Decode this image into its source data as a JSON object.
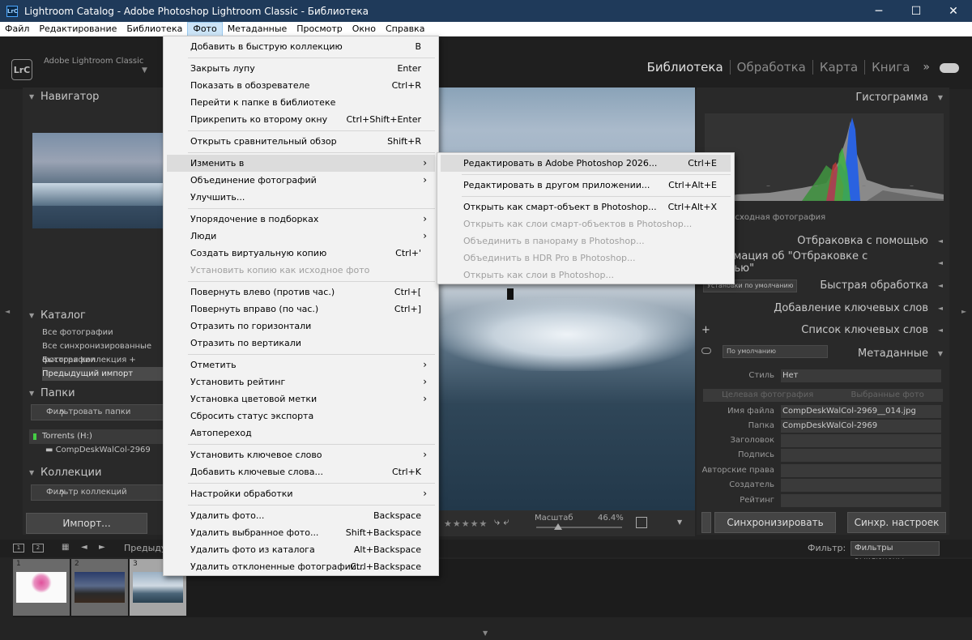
{
  "window": {
    "app_icon": "LrC",
    "title": "Lightroom Catalog - Adobe Photoshop Lightroom Classic - Библиотека",
    "minimize": "─",
    "maximize": "☐",
    "close": "✕"
  },
  "menubar": [
    "Файл",
    "Редактирование",
    "Библиотека",
    "Фото",
    "Метаданные",
    "Просмотр",
    "Окно",
    "Справка"
  ],
  "identity": {
    "badge": "LrC",
    "brand": "Adobe Lightroom Classic",
    "arrow": "▼"
  },
  "modules": {
    "items": [
      "Библиотека",
      "Обработка",
      "Карта",
      "Книга"
    ],
    "more": "»"
  },
  "left_panel": {
    "navigator": "Навигатор",
    "catalog": "Каталог",
    "catalog_items": [
      "Все фотографии",
      "Все синхронизированные фотографии",
      "Быстрая коллекция  +",
      "Предыдущий импорт"
    ],
    "folders": "Папки",
    "filter_folders": "Фильтровать папки",
    "volume": "Torrents (H:)",
    "folder_name": "CompDeskWalCol-2969",
    "collections": "Коллекции",
    "filter_collections": "Фильтр коллекций",
    "import_button": "Импорт..."
  },
  "toolbar": {
    "stars": "★★★★★",
    "rotate": "⤷ ⤶",
    "zoom_label": "Масштаб",
    "zoom_value": "46.4%",
    "zoom_level": 0.3
  },
  "right_panel": {
    "histogram": "Гистограмма",
    "hist_dashes": [
      "–",
      "–",
      "–",
      "–",
      "–"
    ],
    "original_photo": "Исходная фотография",
    "sections": [
      "Отбраковка с помощью",
      "Информация об \"Отбраковке с помощью\"",
      "Быстрая обработка",
      "Добавление ключевых слов",
      "Список ключевых слов",
      "Метаданные"
    ],
    "quick_preset": "Установки по умолчанию",
    "meta_preset": "По умолчанию",
    "style_label": "Стиль",
    "style_value": "Нет",
    "tab_target": "Целевая фотография",
    "tab_selected": "Выбранные фото",
    "metadata": [
      {
        "label": "Имя файла",
        "value": "CompDeskWalCol-2969__014.jpg"
      },
      {
        "label": "Папка",
        "value": "CompDeskWalCol-2969"
      },
      {
        "label": "Заголовок",
        "value": ""
      },
      {
        "label": "Подпись",
        "value": ""
      },
      {
        "label": "Авторские права",
        "value": ""
      },
      {
        "label": "Создатель",
        "value": ""
      },
      {
        "label": "Рейтинг",
        "value": ""
      }
    ],
    "sync_button": "Синхронизировать",
    "sync_settings_button": "Синхр. настроек"
  },
  "filmstrip_bar": {
    "monitor1": "1",
    "monitor2": "2",
    "prev": "◄",
    "next": "►",
    "source": "Предыдущий импорт",
    "filter_label": "Фильтр:",
    "filter_value": "Фильтры выключены"
  },
  "filmstrip": {
    "numbers": [
      "1",
      "2",
      "3"
    ],
    "subjects": [
      "flower",
      "landscape",
      "sea"
    ],
    "selected_index": 2
  },
  "photo_menu": {
    "items": [
      {
        "label": "Добавить в быструю коллекцию",
        "shortcut": "B",
        "arrow": "",
        "disabled": false,
        "hl": false
      },
      {
        "sep": true
      },
      {
        "label": "Закрыть лупу",
        "shortcut": "Enter",
        "arrow": "",
        "disabled": false,
        "hl": false
      },
      {
        "label": "Показать в обозревателе",
        "shortcut": "Ctrl+R",
        "arrow": "",
        "disabled": false,
        "hl": false
      },
      {
        "label": "Перейти к папке в библиотеке",
        "shortcut": "",
        "arrow": "",
        "disabled": false,
        "hl": false
      },
      {
        "label": "Прикрепить ко второму окну",
        "shortcut": "Ctrl+Shift+Enter",
        "arrow": "",
        "disabled": false,
        "hl": false
      },
      {
        "sep": true
      },
      {
        "label": "Открыть сравнительный обзор",
        "shortcut": "Shift+R",
        "arrow": "",
        "disabled": false,
        "hl": false
      },
      {
        "sep": true
      },
      {
        "label": "Изменить в",
        "shortcut": "",
        "arrow": "›",
        "disabled": false,
        "hl": true
      },
      {
        "label": "Объединение фотографий",
        "shortcut": "",
        "arrow": "›",
        "disabled": false,
        "hl": false
      },
      {
        "label": "Улучшить...",
        "shortcut": "",
        "arrow": "",
        "disabled": false,
        "hl": false
      },
      {
        "sep": true
      },
      {
        "label": "Упорядочение в подборках",
        "shortcut": "",
        "arrow": "›",
        "disabled": false,
        "hl": false
      },
      {
        "label": "Люди",
        "shortcut": "",
        "arrow": "›",
        "disabled": false,
        "hl": false
      },
      {
        "label": "Создать виртуальную копию",
        "shortcut": "Ctrl+'",
        "arrow": "",
        "disabled": false,
        "hl": false
      },
      {
        "label": "Установить копию как исходное фото",
        "shortcut": "",
        "arrow": "",
        "disabled": true,
        "hl": false
      },
      {
        "sep": true
      },
      {
        "label": "Повернуть влево (против час.)",
        "shortcut": "Ctrl+[",
        "arrow": "",
        "disabled": false,
        "hl": false
      },
      {
        "label": "Повернуть вправо (по час.)",
        "shortcut": "Ctrl+]",
        "arrow": "",
        "disabled": false,
        "hl": false
      },
      {
        "label": "Отразить по горизонтали",
        "shortcut": "",
        "arrow": "",
        "disabled": false,
        "hl": false
      },
      {
        "label": "Отразить по вертикали",
        "shortcut": "",
        "arrow": "",
        "disabled": false,
        "hl": false
      },
      {
        "sep": true
      },
      {
        "label": "Отметить",
        "shortcut": "",
        "arrow": "›",
        "disabled": false,
        "hl": false
      },
      {
        "label": "Установить рейтинг",
        "shortcut": "",
        "arrow": "›",
        "disabled": false,
        "hl": false
      },
      {
        "label": "Установка цветовой метки",
        "shortcut": "",
        "arrow": "›",
        "disabled": false,
        "hl": false
      },
      {
        "label": "Сбросить статус экспорта",
        "shortcut": "",
        "arrow": "",
        "disabled": false,
        "hl": false
      },
      {
        "label": "Автопереход",
        "shortcut": "",
        "arrow": "",
        "disabled": false,
        "hl": false
      },
      {
        "sep": true
      },
      {
        "label": "Установить ключевое слово",
        "shortcut": "",
        "arrow": "›",
        "disabled": false,
        "hl": false
      },
      {
        "label": "Добавить ключевые слова...",
        "shortcut": "Ctrl+K",
        "arrow": "",
        "disabled": false,
        "hl": false
      },
      {
        "sep": true
      },
      {
        "label": "Настройки обработки",
        "shortcut": "",
        "arrow": "›",
        "disabled": false,
        "hl": false
      },
      {
        "sep": true
      },
      {
        "label": "Удалить фото...",
        "shortcut": "Backspace",
        "arrow": "",
        "disabled": false,
        "hl": false
      },
      {
        "label": "Удалить выбранное фото...",
        "shortcut": "Shift+Backspace",
        "arrow": "",
        "disabled": false,
        "hl": false
      },
      {
        "label": "Удалить фото из каталога",
        "shortcut": "Alt+Backspace",
        "arrow": "",
        "disabled": false,
        "hl": false
      },
      {
        "label": "Удалить отклоненные фотографии...",
        "shortcut": "Ctrl+Backspace",
        "arrow": "",
        "disabled": false,
        "hl": false
      }
    ]
  },
  "edit_in_submenu": {
    "items": [
      {
        "label": "Редактировать в Adobe Photoshop 2026...",
        "shortcut": "Ctrl+E",
        "disabled": false,
        "hl": true
      },
      {
        "sep": true
      },
      {
        "label": "Редактировать в другом приложении...",
        "shortcut": "Ctrl+Alt+E",
        "disabled": false,
        "hl": false
      },
      {
        "sep": true
      },
      {
        "label": "Открыть как смарт-объект в Photoshop...",
        "shortcut": "Ctrl+Alt+X",
        "disabled": false,
        "hl": false
      },
      {
        "label": "Открыть как слои смарт-объектов в Photoshop...",
        "shortcut": "",
        "disabled": true,
        "hl": false
      },
      {
        "label": "Объединить в панораму в Photoshop...",
        "shortcut": "",
        "disabled": true,
        "hl": false
      },
      {
        "label": "Объединить в HDR Pro в Photoshop...",
        "shortcut": "",
        "disabled": true,
        "hl": false
      },
      {
        "label": "Открыть как слои в Photoshop...",
        "shortcut": "",
        "disabled": true,
        "hl": false
      }
    ]
  },
  "colors": {
    "titlebar": "#1f3a5a",
    "panel": "#292929",
    "menu_bg": "#f2f2f2",
    "highlight": "#dcdcdc"
  }
}
